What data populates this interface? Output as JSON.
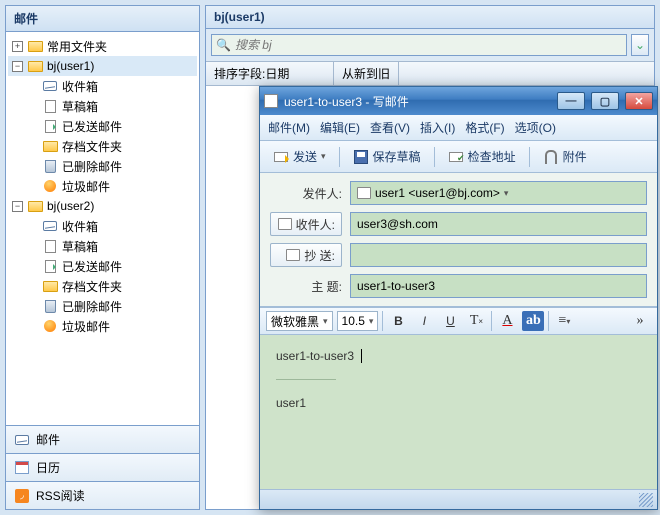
{
  "sidebar": {
    "title": "邮件",
    "common_folders": "常用文件夹",
    "accounts": [
      {
        "name": "bj(user1)"
      },
      {
        "name": "bj(user2)"
      }
    ],
    "folders": {
      "inbox": "收件箱",
      "drafts": "草稿箱",
      "sent": "已发送邮件",
      "archive": "存档文件夹",
      "deleted": "已删除邮件",
      "junk": "垃圾邮件"
    },
    "bottom": {
      "mail": "邮件",
      "calendar": "日历",
      "rss": "RSS阅读"
    }
  },
  "list": {
    "title": "bj(user1)",
    "search_placeholder": "搜索 bj",
    "sort_field_label": "排序字段:",
    "sort_field_value": "日期",
    "sort_order": "从新到旧"
  },
  "compose": {
    "window_title": "user1-to-user3 - 写邮件",
    "menu": {
      "mail": "邮件(M)",
      "edit": "编辑(E)",
      "view": "查看(V)",
      "insert": "插入(I)",
      "format": "格式(F)",
      "options": "选项(O)"
    },
    "toolbar": {
      "send": "发送",
      "save": "保存草稿",
      "check": "检查地址",
      "attach": "附件"
    },
    "fields": {
      "from_label": "发件人:",
      "from_value": "user1 <user1@bj.com>",
      "to_label": "收件人:",
      "to_value": "user3@sh.com",
      "cc_label": "抄  送:",
      "cc_value": "",
      "subject_label": "主  题:",
      "subject_value": "user1-to-user3"
    },
    "format": {
      "font": "微软雅黑",
      "size": "10.5"
    },
    "body_line1": "user1-to-user3",
    "body_line2": "user1"
  }
}
